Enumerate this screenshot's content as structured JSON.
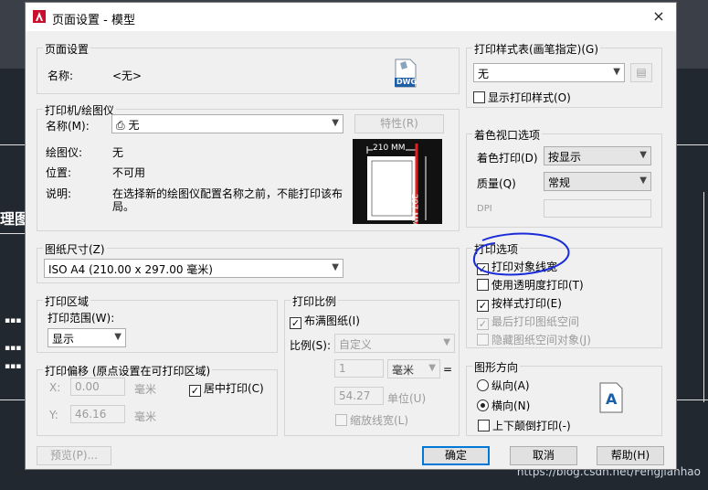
{
  "dialog": {
    "title": "页面设置 - 模型",
    "close_glyph": "×"
  },
  "page_setup": {
    "group_title": "页面设置",
    "name_label": "名称:",
    "name_value": "<无>",
    "icon_text": "DWG"
  },
  "plotter": {
    "group_title": "打印机/绘图仪",
    "name_label": "名称(M):",
    "name_value": "无",
    "properties_button": "特性(R)",
    "plotter_label": "绘图仪:",
    "plotter_value": "无",
    "location_label": "位置:",
    "location_value": "不可用",
    "description_label": "说明:",
    "description_value_1": "在选择新的绘图仪配置名称之前，不能打印该布",
    "description_value_2": "局。",
    "preview_width": "210 MM",
    "preview_height": "297 MM"
  },
  "paper_size": {
    "group_title": "图纸尺寸(Z)",
    "value": "ISO A4 (210.00 x 297.00 毫米)"
  },
  "plot_area": {
    "group_title": "打印区域",
    "range_label": "打印范围(W):",
    "range_value": "显示"
  },
  "plot_offset": {
    "group_title": "打印偏移 (原点设置在可打印区域)",
    "x_label": "X:",
    "x_value": "0.00",
    "x_unit": "毫米",
    "y_label": "Y:",
    "y_value": "46.16",
    "y_unit": "毫米",
    "center_label": "居中打印(C)"
  },
  "plot_scale": {
    "group_title": "打印比例",
    "fit_label": "布满图纸(I)",
    "scale_label": "比例(S):",
    "scale_value": "自定义",
    "value1": "1",
    "unit_value": "毫米",
    "equals": "=",
    "value2": "54.27",
    "unit2_label": "单位(U)",
    "lineweight_label": "缩放线宽(L)"
  },
  "plot_style_table": {
    "group_title": "打印样式表(画笔指定)(G)",
    "value": "无",
    "display_label": "显示打印样式(O)"
  },
  "shaded_viewport": {
    "group_title": "着色视口选项",
    "shade_label": "着色打印(D)",
    "shade_value": "按显示",
    "quality_label": "质量(Q)",
    "quality_value": "常规",
    "dpi_label": "DPI"
  },
  "plot_options": {
    "group_title": "打印选项",
    "items": [
      {
        "label": "打印对象线宽",
        "checked": true,
        "enabled": true
      },
      {
        "label": "使用透明度打印(T)",
        "checked": false,
        "enabled": true
      },
      {
        "label": "按样式打印(E)",
        "checked": true,
        "enabled": true
      },
      {
        "label": "最后打印图纸空间",
        "checked": true,
        "enabled": false
      },
      {
        "label": "隐藏图纸空间对象(J)",
        "checked": false,
        "enabled": false
      }
    ]
  },
  "orientation": {
    "group_title": "图形方向",
    "portrait_label": "纵向(A)",
    "landscape_label": "横向(N)",
    "upside_down_label": "上下颠倒打印(-)",
    "icon_letter": "A"
  },
  "buttons": {
    "preview": "预览(P)...",
    "ok": "确定",
    "cancel": "取消",
    "help": "帮助(H)"
  },
  "background": {
    "watermark": "https://blog.csdn.net/Fengjianhao",
    "cad_text": "理图"
  },
  "colors": {
    "annotation_circle": "#1a2bd8",
    "preview_red_line": "#e0201e",
    "default_button_border": "#0078d7"
  }
}
